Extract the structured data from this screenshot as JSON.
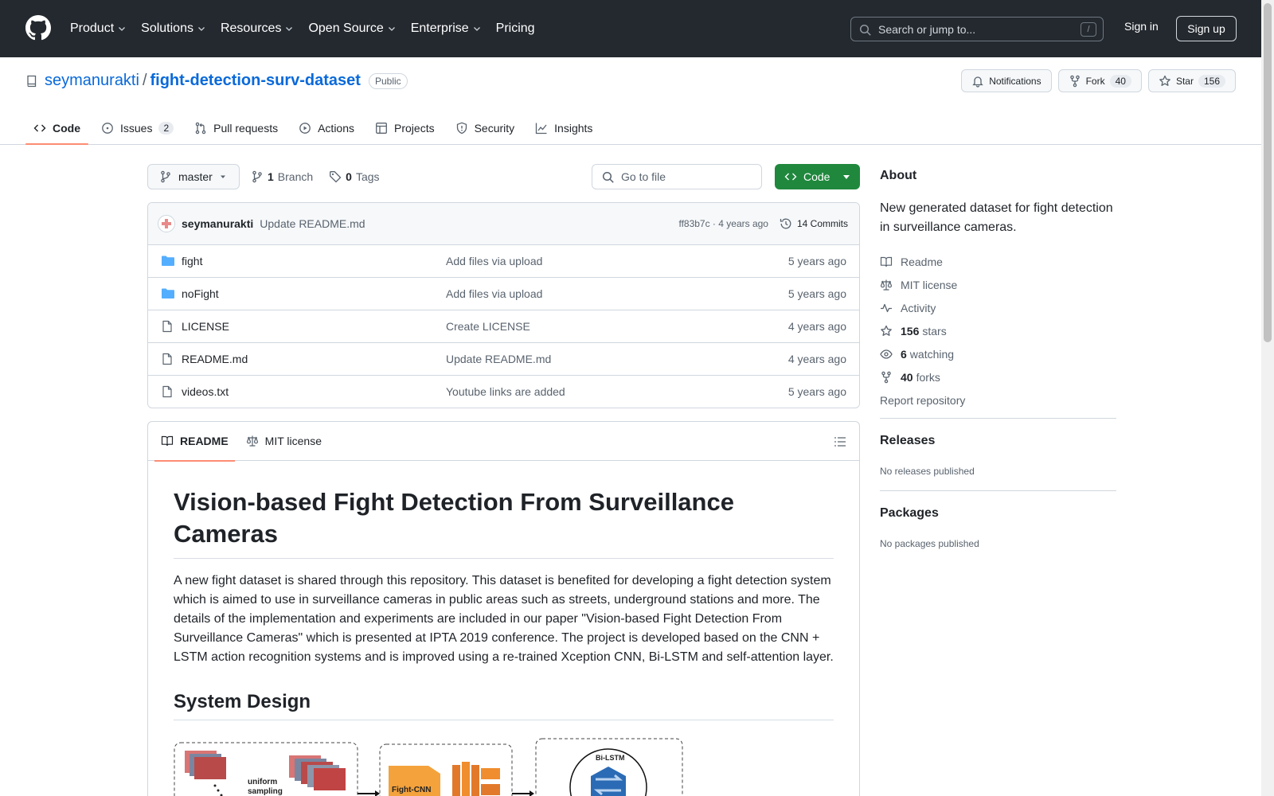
{
  "header": {
    "nav": [
      "Product",
      "Solutions",
      "Resources",
      "Open Source",
      "Enterprise",
      "Pricing"
    ],
    "search_placeholder": "Search or jump to...",
    "search_shortcut": "/",
    "sign_in": "Sign in",
    "sign_up": "Sign up"
  },
  "repo": {
    "owner": "seymanurakti",
    "separator": "/",
    "name": "fight-detection-surv-dataset",
    "visibility": "Public",
    "notifications_label": "Notifications",
    "fork_label": "Fork",
    "fork_count": "40",
    "star_label": "Star",
    "star_count": "156"
  },
  "tabs": [
    {
      "label": "Code",
      "icon": "code-icon"
    },
    {
      "label": "Issues",
      "icon": "issue-icon",
      "count": "2"
    },
    {
      "label": "Pull requests",
      "icon": "pull-request-icon"
    },
    {
      "label": "Actions",
      "icon": "play-icon"
    },
    {
      "label": "Projects",
      "icon": "table-icon"
    },
    {
      "label": "Security",
      "icon": "shield-icon"
    },
    {
      "label": "Insights",
      "icon": "graph-icon"
    }
  ],
  "toolbar": {
    "branch": "master",
    "branch_count": "1",
    "branch_label": "Branch",
    "tag_count": "0",
    "tag_label": "Tags",
    "goto_placeholder": "Go to file",
    "code_button": "Code"
  },
  "commit": {
    "author": "seymanurakti",
    "message": "Update README.md",
    "hash_time": "ff83b7c · 4 years ago",
    "commits_label": "14 Commits"
  },
  "files": [
    {
      "name": "fight",
      "type": "folder",
      "message": "Add files via upload",
      "date": "5 years ago"
    },
    {
      "name": "noFight",
      "type": "folder",
      "message": "Add files via upload",
      "date": "5 years ago"
    },
    {
      "name": "LICENSE",
      "type": "file",
      "message": "Create LICENSE",
      "date": "4 years ago"
    },
    {
      "name": "README.md",
      "type": "file",
      "message": "Update README.md",
      "date": "4 years ago"
    },
    {
      "name": "videos.txt",
      "type": "file",
      "message": "Youtube links are added",
      "date": "5 years ago"
    }
  ],
  "readme": {
    "tab_readme": "README",
    "tab_license": "MIT license",
    "title": "Vision-based Fight Detection From Surveillance Cameras",
    "paragraph": "A new fight dataset is shared through this repository. This dataset is benefited for developing a fight detection system which is aimed to use in surveillance cameras in public areas such as streets, underground stations and more. The details of the implementation and experiments are included in our paper \"Vision-based Fight Detection From Surveillance Cameras\" which is presented at IPTA 2019 conference. The project is developed based on the CNN + LSTM action recognition systems and is improved using a re-trained Xception CNN, Bi-LSTM and self-attention layer.",
    "h2": "System Design",
    "diagram_sampling": "uniform sampling",
    "diagram_cnn": "Fight-CNN",
    "diagram_lstm": "Bi-LSTM"
  },
  "about": {
    "heading": "About",
    "description": "New generated dataset for fight detection in surveillance cameras.",
    "items": [
      {
        "icon": "book-icon",
        "label": "Readme"
      },
      {
        "icon": "law-icon",
        "label": "MIT license"
      },
      {
        "icon": "pulse-icon",
        "label": "Activity"
      },
      {
        "icon": "star-icon",
        "count": "156",
        "label": "stars"
      },
      {
        "icon": "eye-icon",
        "count": "6",
        "label": "watching"
      },
      {
        "icon": "fork-icon",
        "count": "40",
        "label": "forks"
      }
    ],
    "report": "Report repository"
  },
  "releases": {
    "heading": "Releases",
    "empty": "No releases published"
  },
  "packages": {
    "heading": "Packages",
    "empty": "No packages published"
  },
  "colors": {
    "header_bg": "#24292f",
    "link": "#0969da",
    "primary_button": "#1f883d",
    "active_tab": "#fd8c73",
    "folder": "#54aeff"
  }
}
